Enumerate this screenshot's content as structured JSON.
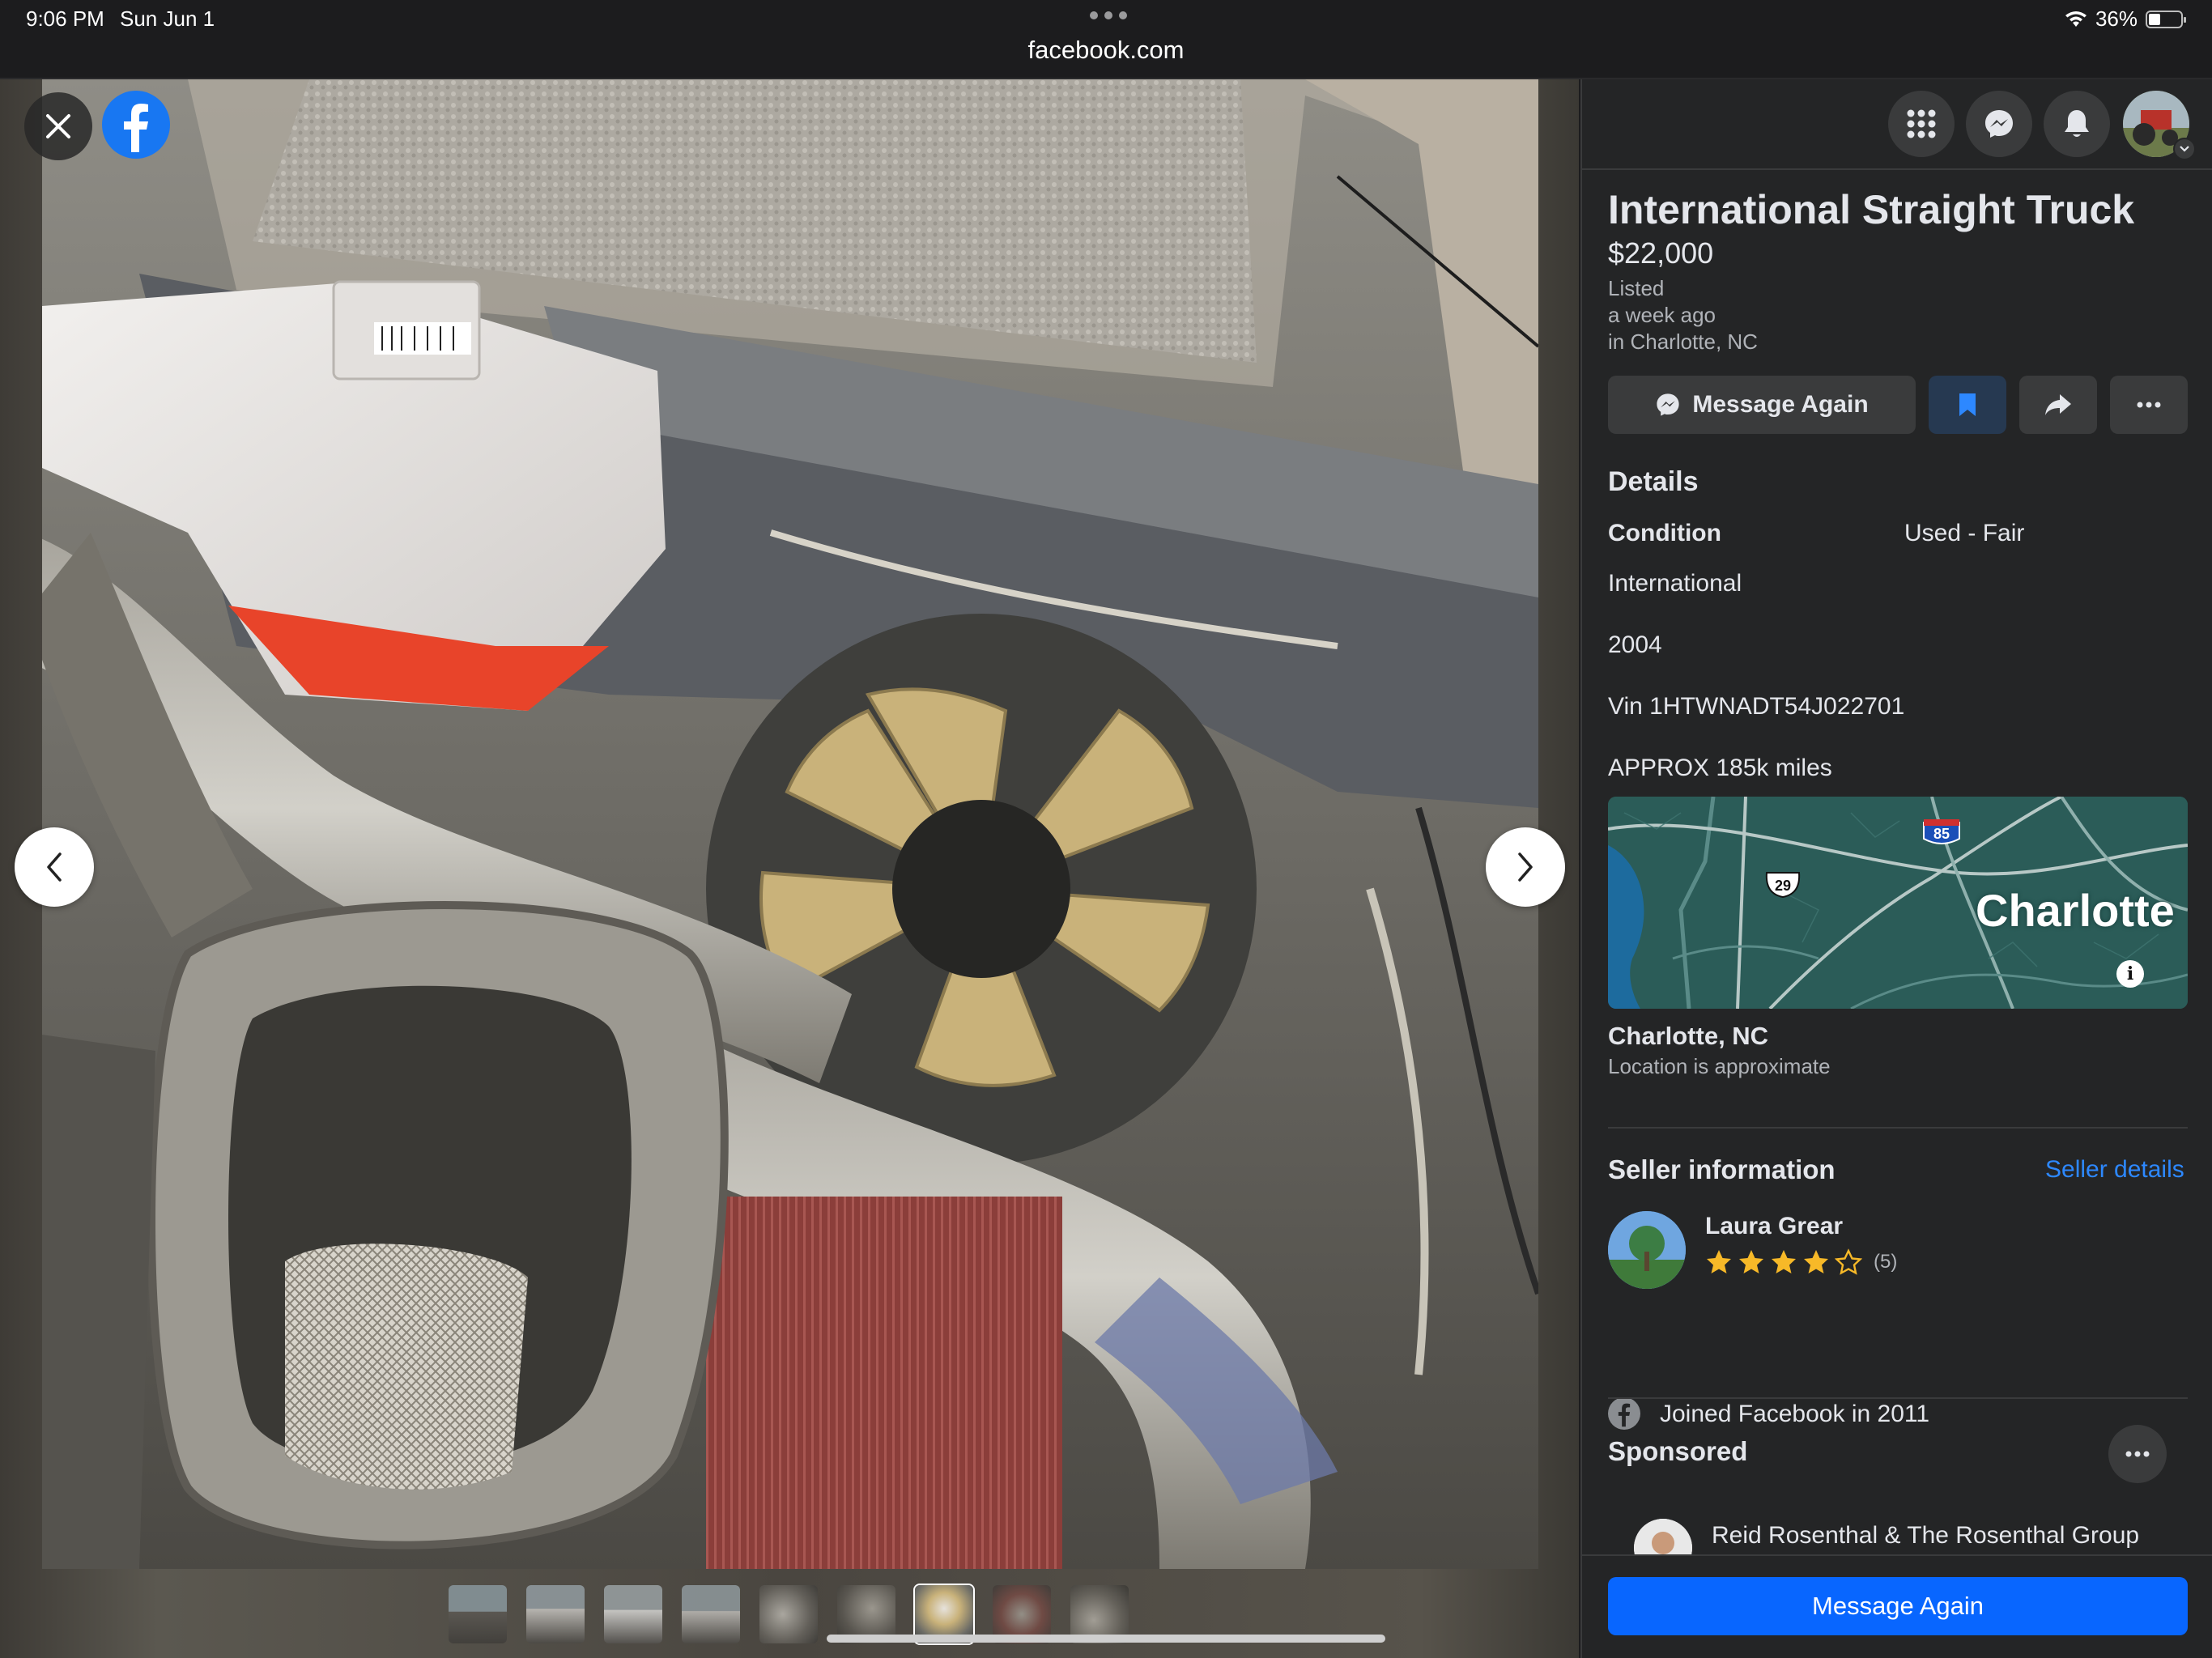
{
  "status_bar": {
    "time": "9:06 PM",
    "date": "Sun Jun 1",
    "url": "facebook.com",
    "battery": "36%"
  },
  "viewer": {
    "thumbnail_count": 9,
    "active_thumbnail": 7
  },
  "listing": {
    "title": "International Straight Truck",
    "price": "$22,000",
    "listed_label": "Listed",
    "listed_time": "a week ago",
    "listed_location": "in Charlotte, NC",
    "message_button": "Message Again"
  },
  "details": {
    "heading": "Details",
    "condition_label": "Condition",
    "condition_value": "Used - Fair",
    "description": [
      "International",
      "2004",
      "Vin 1HTWNADT54J022701",
      "APPROX 185k miles"
    ]
  },
  "map": {
    "city_label": "Charlotte",
    "route_85": "85",
    "route_29": "29",
    "info": "i"
  },
  "location": {
    "name": "Charlotte, NC",
    "note": "Location is approximate"
  },
  "seller": {
    "heading": "Seller information",
    "details_link": "Seller details",
    "name": "Laura Grear",
    "rating": 4,
    "rating_max": 5,
    "rating_count": "(5)",
    "joined": "Joined Facebook in 2011"
  },
  "sponsored": {
    "heading": "Sponsored",
    "advertiser": "Reid Rosenthal & The Rosenthal Group"
  },
  "bottom_button": "Message Again",
  "colors": {
    "primary": "#0866ff",
    "link": "#2d88ff",
    "panel": "#242526",
    "star": "#f7b928"
  }
}
